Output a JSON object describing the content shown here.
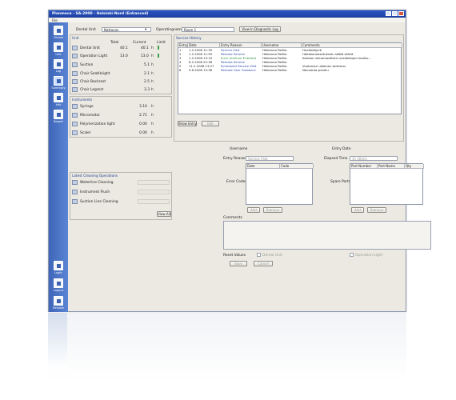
{
  "window": {
    "title": "Planmeca - SA-2000 - Helsinki-Nord (Enhanced)",
    "menu": [
      "File"
    ]
  },
  "toolbar": {
    "dental_unit_label": "Dental Unit",
    "dental_unit_value": "Nattanen",
    "operating_name_label": "Operatingname",
    "operating_name_value": "Room 1",
    "view_log_label": "View In Diagnostic Log"
  },
  "sidebar": {
    "items": [
      {
        "label": "Clients",
        "icon": "clients-icon"
      },
      {
        "label": "Unit",
        "icon": "unit-icon"
      },
      {
        "label": "Log",
        "icon": "log-icon"
      },
      {
        "label": "Summary",
        "icon": "summary-icon"
      },
      {
        "label": "Info",
        "icon": "info-icon"
      },
      {
        "label": "Report",
        "icon": "report-icon"
      },
      {
        "label": "Login",
        "icon": "login-icon"
      },
      {
        "label": "Logout",
        "icon": "logout-icon"
      },
      {
        "label": "Remote",
        "icon": "remote-icon"
      }
    ]
  },
  "unit_panel": {
    "title": "Unit",
    "col_total": "Total",
    "col_current": "Current",
    "col_limit": "Limit",
    "rows": [
      {
        "name": "Dental Unit",
        "total": "40.1",
        "current": "40.1",
        "unit": "h",
        "icon": "dental-unit-icon"
      },
      {
        "name": "Operation Light",
        "total": "13.0",
        "current": "13.0",
        "unit": "h",
        "icon": "light-icon"
      },
      {
        "name": "Suction",
        "total": "",
        "current": "5.1",
        "unit": "h",
        "icon": "suction-icon"
      },
      {
        "name": "Chair SeatHeight",
        "total": "",
        "current": "2.1",
        "unit": "h",
        "icon": "chair-icon"
      },
      {
        "name": "Chair Backrest",
        "total": "",
        "current": "2.5",
        "unit": "h",
        "icon": "chair-icon"
      },
      {
        "name": "Chair Legrest",
        "total": "",
        "current": "3.3",
        "unit": "h",
        "icon": "chair-icon"
      }
    ]
  },
  "instruments_panel": {
    "title": "Instruments",
    "rows": [
      {
        "name": "Syringe",
        "current": "3.10",
        "unit": "h",
        "icon": "syringe-icon"
      },
      {
        "name": "Micromotor",
        "current": "2.71",
        "unit": "h",
        "icon": "micromotor-icon"
      },
      {
        "name": "Polymerization light",
        "current": "0.00",
        "unit": "h",
        "icon": "polymerization-icon"
      },
      {
        "name": "Scaler",
        "current": "0.00",
        "unit": "h",
        "icon": "scaler-icon"
      }
    ]
  },
  "cleaning_panel": {
    "title": "Latest Cleaning Operations",
    "rows": [
      {
        "name": "Waterline Cleaning",
        "icon": "waterline-icon"
      },
      {
        "name": "Instrument Flush",
        "icon": "flush-icon"
      },
      {
        "name": "Suction Line Cleaning",
        "icon": "suction-line-icon"
      }
    ],
    "view_all": "View All"
  },
  "service_history": {
    "title": "Service History",
    "columns": [
      "Entry ID",
      "Date",
      "Entry Reason",
      "Username",
      "Comments"
    ],
    "rows": [
      {
        "id": "1",
        "date": "1.2.2008 11:39",
        "reason": "Service Visit",
        "reason_color": "blue",
        "user": "Heikanna Paltilo",
        "comment": "Huoltokäynti"
      },
      {
        "id": "2",
        "date": "1.2.2008 11:59",
        "reason": "Remote Service",
        "reason_color": "blue",
        "user": "Heikanna Paltilo",
        "comment": "Hoitokoneasetuksien säätö etänä"
      },
      {
        "id": "3",
        "date": "1.2.2008 13:19",
        "reason": "Error (Instrum Entered)",
        "reason_color": "green",
        "user": "Heikanna Paltilo",
        "comment": "Kahdan mikromoottorin vesiletkujen kauttu..."
      },
      {
        "id": "4",
        "date": "6.2.2008 22:38",
        "reason": "Remote Service",
        "reason_color": "blue",
        "user": "Heikanna Paltilo",
        "comment": ""
      },
      {
        "id": "5",
        "date": "11.2.2008 13:27",
        "reason": "Scheduled Service Visit",
        "reason_color": "blue",
        "user": "Heikanna Paltilo",
        "comment": "Vuotuinen ulkoinen tarkistus"
      },
      {
        "id": "6",
        "date": "9.6.2008 13:38",
        "reason": "Remote User Guidance",
        "reason_color": "blue",
        "user": "Heikanna Paltilo",
        "comment": "Neuvonta-puhelu"
      }
    ],
    "show_entry": "Show Entry",
    "edit": "Edit"
  },
  "entry_form": {
    "username_label": "Username",
    "entry_date_label": "Entry Date",
    "entry_reason_label": "Entry Reason",
    "entry_reason_value": "Service Visit",
    "elapsed_time_label": "Elapsed Time",
    "elapsed_time_value": "1h 30min",
    "error_codes_label": "Error Codes",
    "error_columns": [
      "Date",
      "Code"
    ],
    "spare_parts_label": "Spare Parts",
    "parts_columns": [
      "Part Number",
      "Part Name",
      "Qty"
    ],
    "add": "Add",
    "remove": "Remove",
    "comments_label": "Comments",
    "reset_values_label": "Reset Values",
    "reset_dental_unit": "Dental Unit",
    "reset_operation_light": "Operation Light",
    "save": "Save",
    "cancel": "Cancel"
  }
}
